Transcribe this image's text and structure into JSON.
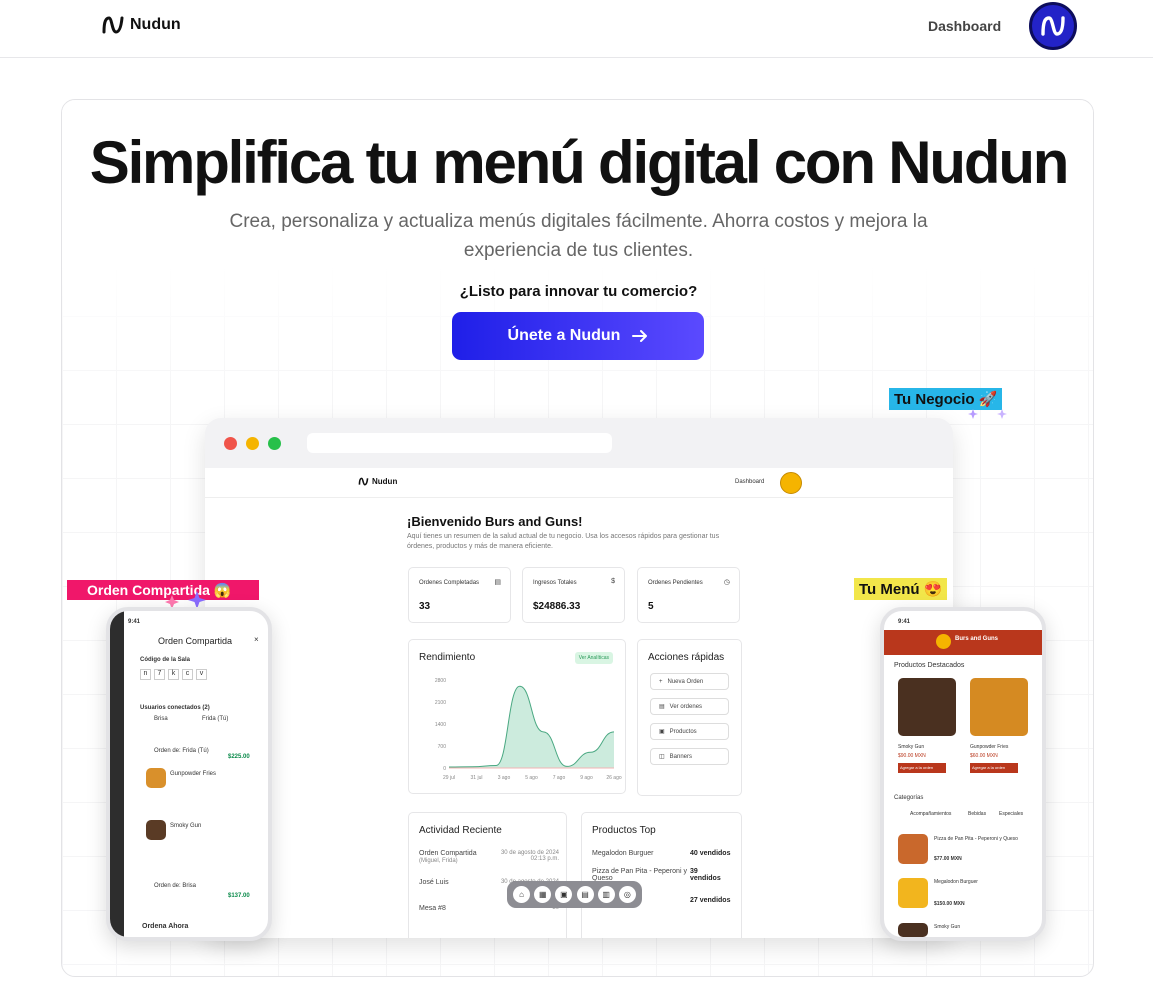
{
  "nav": {
    "brand": "Nudun",
    "dashboard_link": "Dashboard"
  },
  "hero": {
    "title": "Simplifica tu menú digital con Nudun",
    "subtitle": "Crea, personaliza y actualiza menús digitales fácilmente. Ahorra costos y mejora la experiencia de tus clientes.",
    "cta_question": "¿Listo para innovar tu comercio?",
    "cta_button": "Únete a Nudun"
  },
  "tags": {
    "negocio": "Tu Negocio 🚀",
    "orden": "Orden Compartida 😱",
    "menu": "Tu Menú 😍"
  },
  "dashboard_mock": {
    "brand": "Nudun",
    "dash_link": "Dashboard",
    "welcome": "¡Bienvenido Burs and Guns!",
    "welcome_sub": "Aquí tienes un resumen de la salud actual de tu negocio. Usa los accesos rápidos para gestionar tus órdenes, productos y más de manera eficiente.",
    "stats": [
      {
        "label": "Ordenes Completadas",
        "value": "33",
        "icon": "▤"
      },
      {
        "label": "Ingresos Totales",
        "value": "$24886.33",
        "icon": "$"
      },
      {
        "label": "Ordenes Pendientes",
        "value": "5",
        "icon": "◷"
      }
    ],
    "rendimiento": {
      "title": "Rendimiento",
      "badge": "Ver Analíticas"
    },
    "acciones": {
      "title": "Acciones rápidas",
      "items": [
        "Nueva Orden",
        "Ver ordenes",
        "Productos",
        "Banners"
      ]
    },
    "actividad": {
      "title": "Actividad Reciente",
      "rows": [
        {
          "text": "Orden Compartida",
          "sub": "(Miguel, Frida)",
          "date": "30 de agosto de 2024 02:13 p.m."
        },
        {
          "text": "José Luis",
          "sub": "",
          "date": "30 de agosto de 2024"
        },
        {
          "text": "Mesa #8",
          "sub": "",
          "date": "30"
        }
      ]
    },
    "productos_top": {
      "title": "Productos Top",
      "rows": [
        {
          "name": "Megalodon Burguer",
          "count": "40 vendidos"
        },
        {
          "name": "Pizza de Pan Pita - Peperoni y Queso",
          "count": "39 vendidos"
        },
        {
          "name": "",
          "count": "27 vendidos"
        }
      ]
    }
  },
  "chart_data": {
    "type": "area",
    "title": "Rendimiento",
    "x": [
      "29 jul",
      "31 jul",
      "3 ago",
      "5 ago",
      "7 ago",
      "9 ago",
      "26 ago"
    ],
    "yticks": [
      "0",
      "700",
      "1400",
      "2100",
      "2800"
    ],
    "ylim": [
      0,
      2800
    ],
    "series": [
      {
        "values": [
          30,
          40,
          80,
          2600,
          1150,
          50,
          500,
          1150
        ]
      }
    ]
  },
  "phone_left": {
    "time": "9:41",
    "title": "Orden Compartida",
    "code_label": "Código de la Sala",
    "code": [
      "n",
      "7",
      "k",
      "c",
      "v"
    ],
    "users_label": "Usuarios conectados (2)",
    "users": [
      "Brisa",
      "Frida (Tú)"
    ],
    "order_from": "Orden de: Frida (Tú)",
    "total": "$225.00",
    "items": [
      "Gunpowder Fries",
      "Smoky Gun"
    ],
    "order_from2": "Orden de: Brisa",
    "total2": "$137.00",
    "footer": "Ordena Ahora"
  },
  "phone_right": {
    "time": "9:41",
    "restaurant": "Burs and Guns",
    "featured": "Productos Destacados",
    "products": [
      {
        "name": "Smoky Gun",
        "price": "$90.00 MXN"
      },
      {
        "name": "Gunpowder Fries",
        "price": "$60.00 MXN"
      }
    ],
    "add_btn": "Agregar a la orden",
    "categories_label": "Categorías",
    "categories": [
      "Acompañamientos",
      "Bebidas",
      "Especiales"
    ],
    "list": [
      {
        "name": "Pizza de Pan Pita - Peperoni y Queso",
        "price": "$77.00 MXN"
      },
      {
        "name": "Megalodon Burguer",
        "price": "$150.00 MXN"
      },
      {
        "name": "Smoky Gun",
        "price": ""
      }
    ]
  }
}
